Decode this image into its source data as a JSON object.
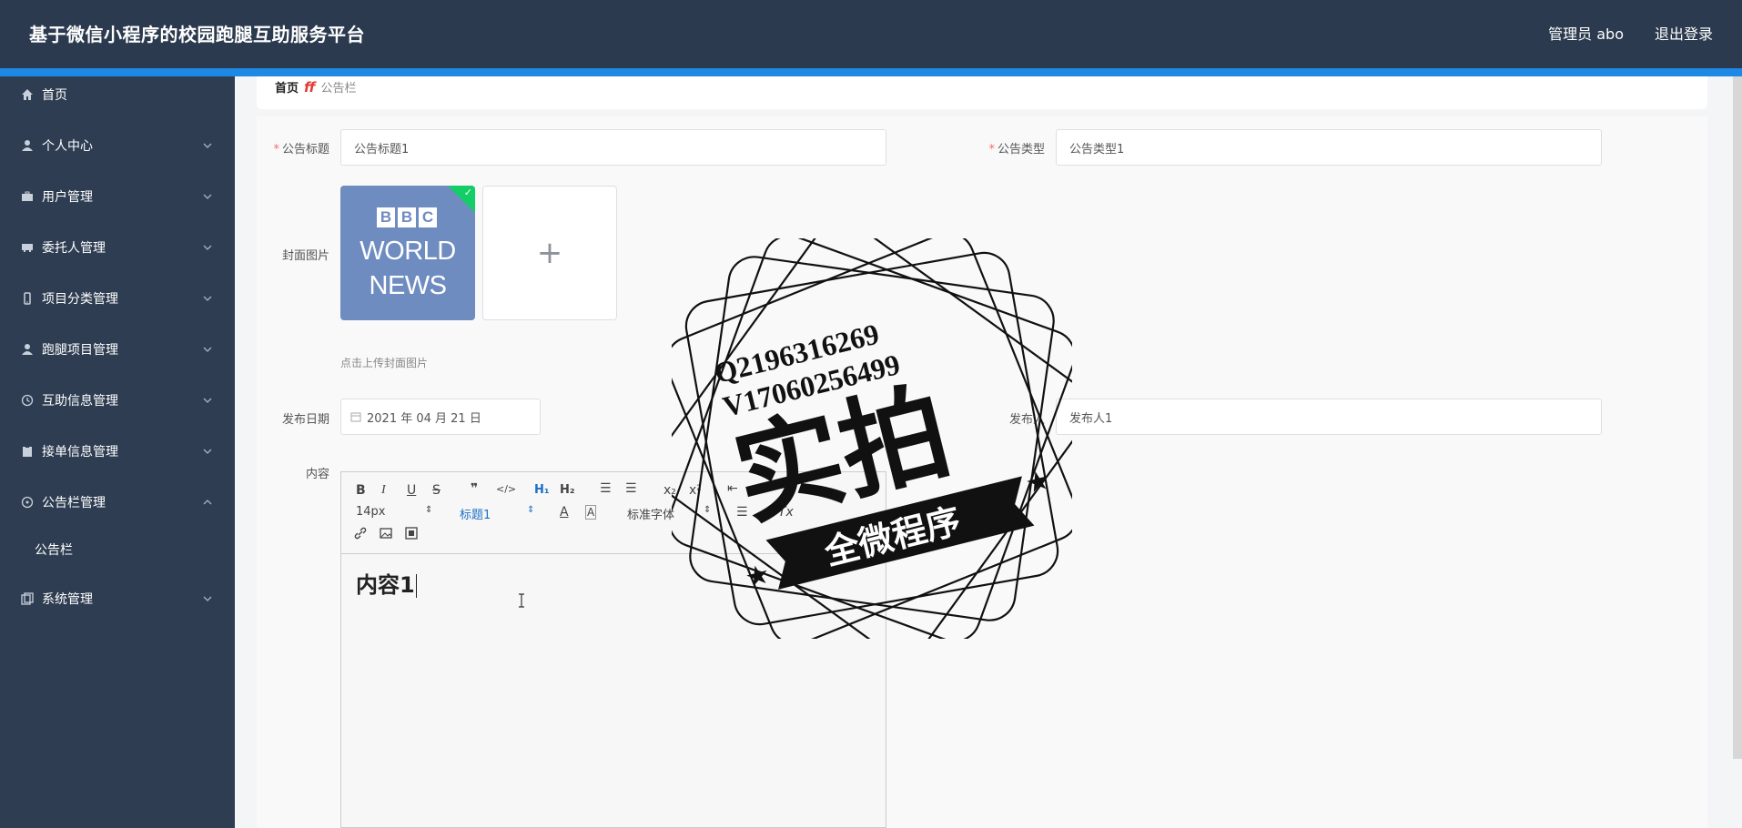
{
  "header": {
    "title": "基于微信小程序的校园跑腿互助服务平台",
    "admin": "管理员 abo",
    "logout": "退出登录"
  },
  "sidebar": {
    "items": [
      {
        "label": "首页",
        "icon": "home-icon"
      },
      {
        "label": "个人中心",
        "icon": "user-icon"
      },
      {
        "label": "用户管理",
        "icon": "briefcase-icon"
      },
      {
        "label": "委托人管理",
        "icon": "card-icon"
      },
      {
        "label": "项目分类管理",
        "icon": "phone-icon"
      },
      {
        "label": "跑腿项目管理",
        "icon": "person-icon"
      },
      {
        "label": "互助信息管理",
        "icon": "clock-icon"
      },
      {
        "label": "接单信息管理",
        "icon": "clipboard-icon"
      },
      {
        "label": "公告栏管理",
        "icon": "compass-icon"
      },
      {
        "label": "系统管理",
        "icon": "copy-icon"
      }
    ],
    "sub_item": "公告栏"
  },
  "breadcrumb": {
    "home": "首页",
    "current": "公告栏"
  },
  "form": {
    "title_label": "公告标题",
    "title_value": "公告标题1",
    "type_label": "公告类型",
    "type_value": "公告类型1",
    "cover_label": "封面图片",
    "upload_tip": "点击上传封面图片",
    "date_label": "发布日期",
    "date_value": "2021 年 04 月 21 日",
    "publisher_label": "发布人",
    "publisher_value": "发布人1",
    "content_label": "内容"
  },
  "cover_image": {
    "letters": [
      "B",
      "B",
      "C"
    ],
    "line1": "WORLD",
    "line2": "NEWS",
    "color": "#6f8cc0"
  },
  "editor": {
    "font_size": "14px",
    "heading": "标题1",
    "font_family": "标准字体",
    "content": "内容1"
  },
  "watermark": {
    "line1": "Q2196316269",
    "line2": "V17060256499",
    "big": "实拍",
    "banner": "全微程序"
  },
  "colors": {
    "header_bg": "#2b3a4e",
    "accent": "#1e88e5",
    "sidebar_bg": "#2e3d52",
    "required": "#f56c6c",
    "success": "#13ce66"
  }
}
